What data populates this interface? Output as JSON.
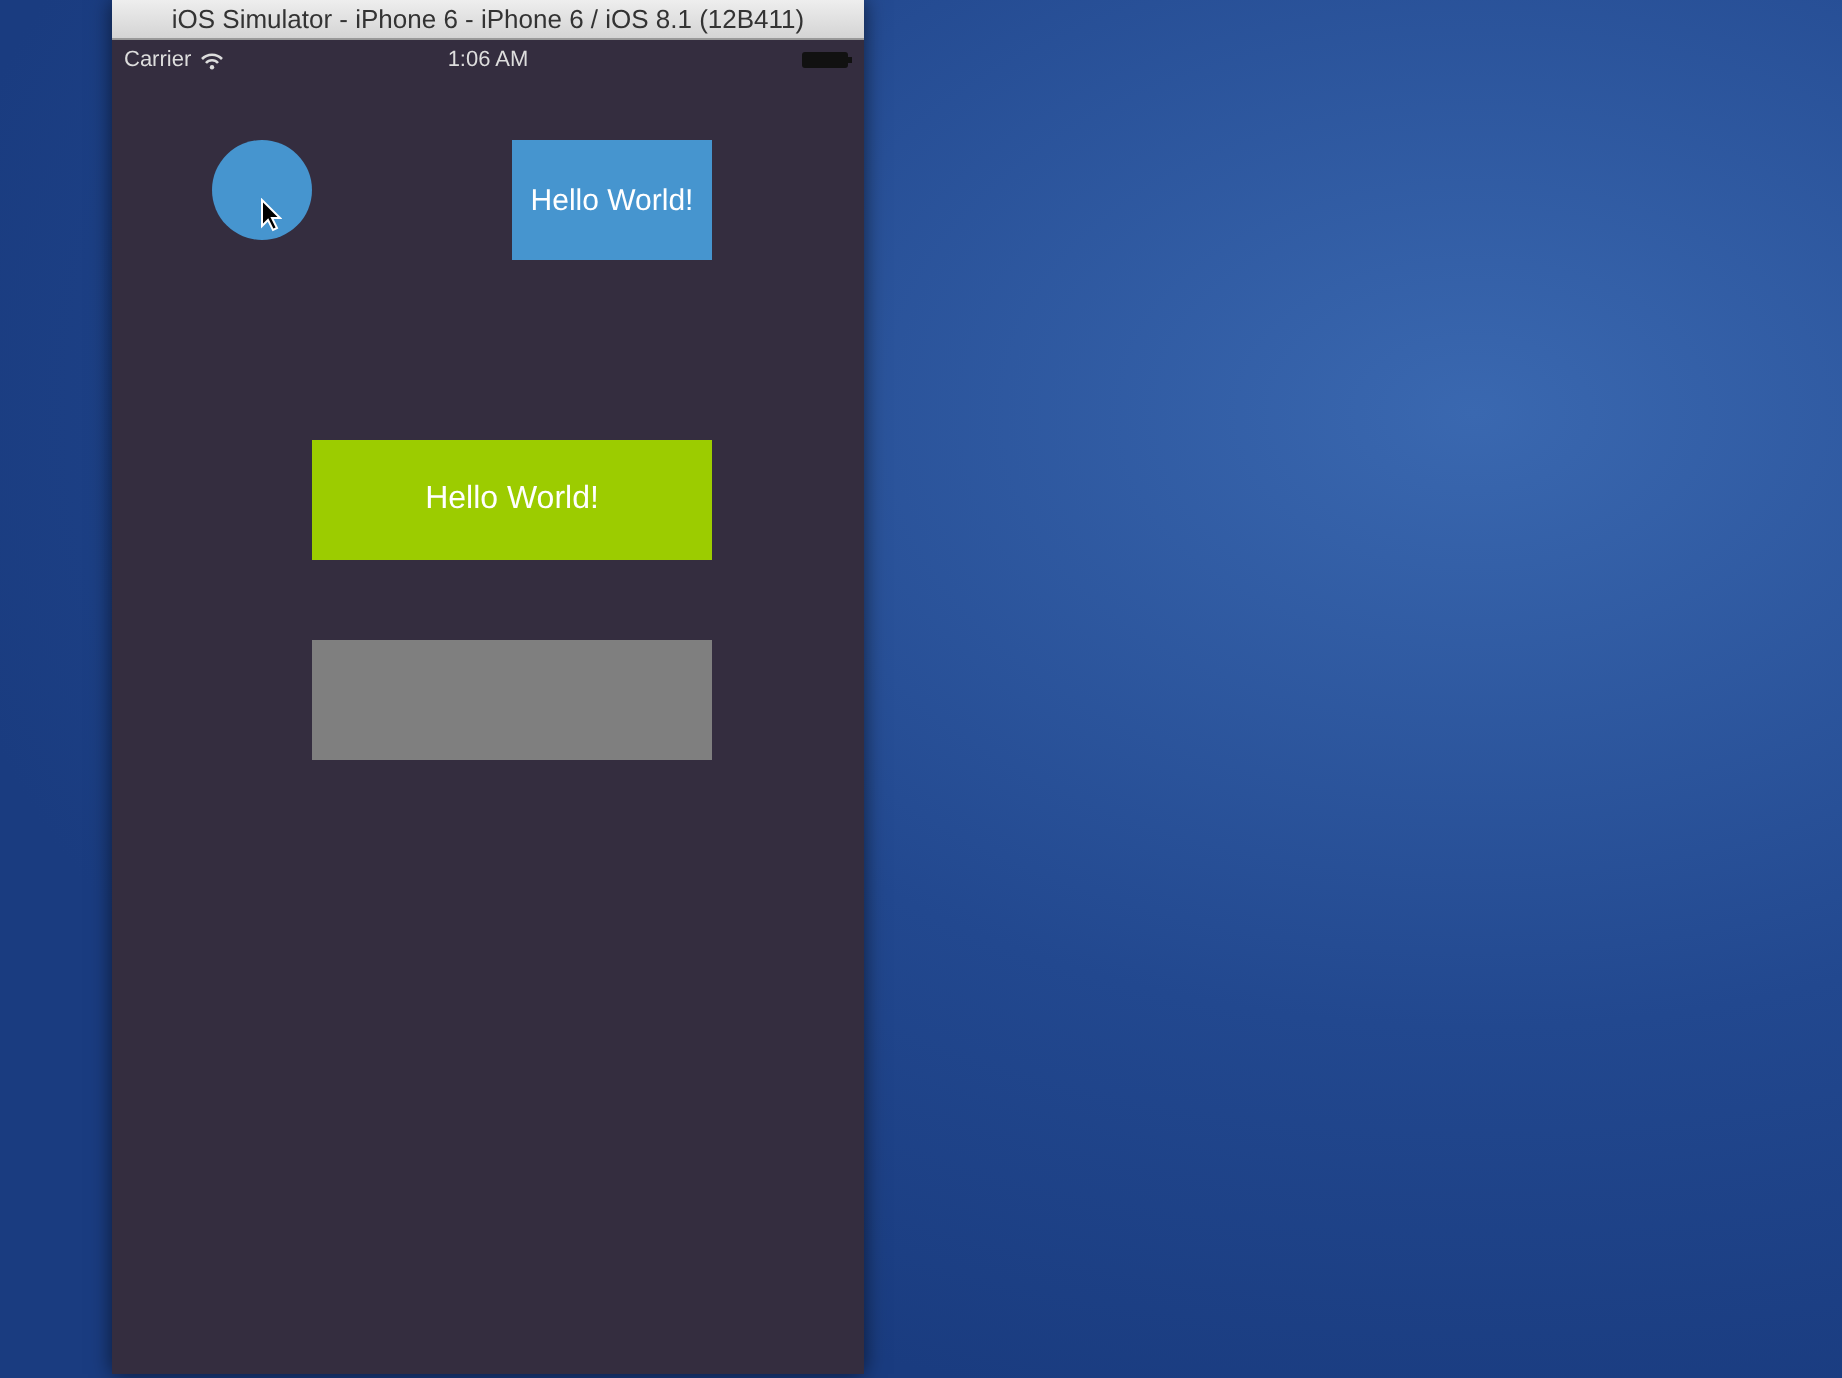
{
  "window": {
    "title": "iOS Simulator - iPhone 6 - iPhone 6 / iOS 8.1 (12B411)"
  },
  "status_bar": {
    "carrier": "Carrier",
    "time": "1:06 AM"
  },
  "views": [
    {
      "kind": "circle",
      "color": "#4695cf"
    },
    {
      "kind": "label",
      "text": "Hello World!",
      "color": "#4695cf"
    },
    {
      "kind": "label",
      "text": "Hello World!",
      "color": "#9ccc00"
    },
    {
      "kind": "block",
      "color": "#7f7f7f"
    }
  ]
}
